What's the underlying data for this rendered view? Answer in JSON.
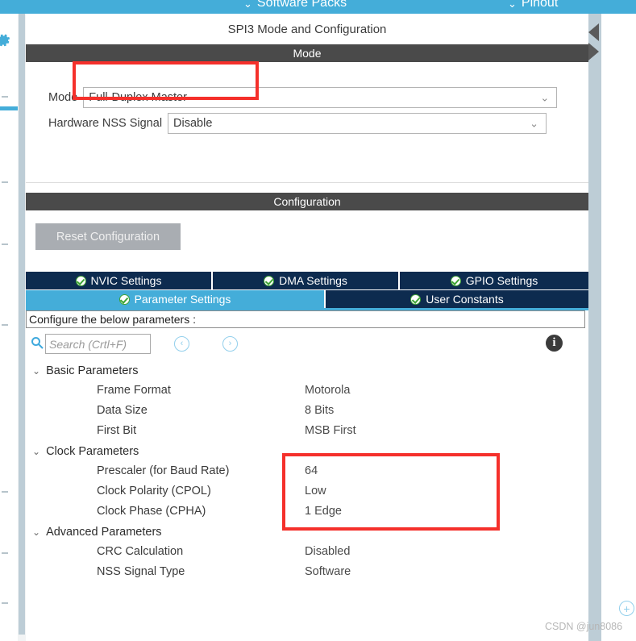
{
  "topbar": {
    "background": "#44add9",
    "items": [
      {
        "label": "Software Packs",
        "icon": "chevron-down-icon"
      },
      {
        "label": "Pinout",
        "icon": "chevron-down-icon"
      }
    ]
  },
  "left_rail": {
    "gear_icon": "gear-icon",
    "accent_color": "#44add9"
  },
  "panel": {
    "title": "SPI3 Mode and Configuration",
    "mode_section": {
      "header": "Mode",
      "fields": [
        {
          "label": "Mode",
          "value": "Full-Duplex Master",
          "icon": "chevron-down-icon"
        },
        {
          "label": "Hardware NSS Signal",
          "value": "Disable",
          "icon": "chevron-down-icon"
        }
      ]
    },
    "config_section": {
      "header": "Configuration",
      "reset_label": "Reset Configuration",
      "tabs_row1": [
        {
          "label": "NVIC Settings",
          "active": false,
          "status_icon": "check-circle-icon"
        },
        {
          "label": "DMA Settings",
          "active": false,
          "status_icon": "check-circle-icon"
        },
        {
          "label": "GPIO Settings",
          "active": false,
          "status_icon": "check-circle-icon"
        }
      ],
      "tabs_row2": [
        {
          "label": "Parameter Settings",
          "active": true,
          "status_icon": "check-circle-icon"
        },
        {
          "label": "User Constants",
          "active": false,
          "status_icon": "check-circle-icon"
        }
      ],
      "configure_hint": "Configure the below parameters :",
      "search": {
        "placeholder": "Search (Crtl+F)",
        "value": "",
        "icon": "search-icon",
        "prev_icon": "chevron-left-circle-icon",
        "next_icon": "chevron-right-circle-icon",
        "info_icon": "info-icon"
      },
      "parameters": [
        {
          "type": "group",
          "label": "Basic Parameters",
          "expanded": true
        },
        {
          "type": "item",
          "name": "Frame Format",
          "value": "Motorola"
        },
        {
          "type": "item",
          "name": "Data Size",
          "value": "8 Bits"
        },
        {
          "type": "item",
          "name": "First Bit",
          "value": "MSB First"
        },
        {
          "type": "group",
          "label": "Clock Parameters",
          "expanded": true
        },
        {
          "type": "item",
          "name": "Prescaler (for Baud Rate)",
          "value": "64"
        },
        {
          "type": "item",
          "name": "Clock Polarity (CPOL)",
          "value": "Low"
        },
        {
          "type": "item",
          "name": "Clock Phase (CPHA)",
          "value": "1 Edge"
        },
        {
          "type": "group",
          "label": "Advanced Parameters",
          "expanded": true
        },
        {
          "type": "item",
          "name": "CRC Calculation",
          "value": "Disabled"
        },
        {
          "type": "item",
          "name": "NSS Signal Type",
          "value": "Software"
        }
      ]
    }
  },
  "annotations": {
    "color": "#f5302b",
    "boxes": [
      {
        "target": "mode-combobox"
      },
      {
        "target": "clock-parameter-values"
      }
    ]
  },
  "edge_nav": {
    "prev_icon": "triangle-left-icon",
    "next_icon": "triangle-right-icon"
  },
  "watermark": {
    "text": "CSDN @jun8086"
  },
  "corner": {
    "plus_icon": "plus-circle-icon"
  },
  "glyphs": {
    "chevron_down": "⌄",
    "twisty_down": "⌄",
    "chev_left": "‹",
    "chev_right": "›",
    "info": "i",
    "plus": "+"
  }
}
